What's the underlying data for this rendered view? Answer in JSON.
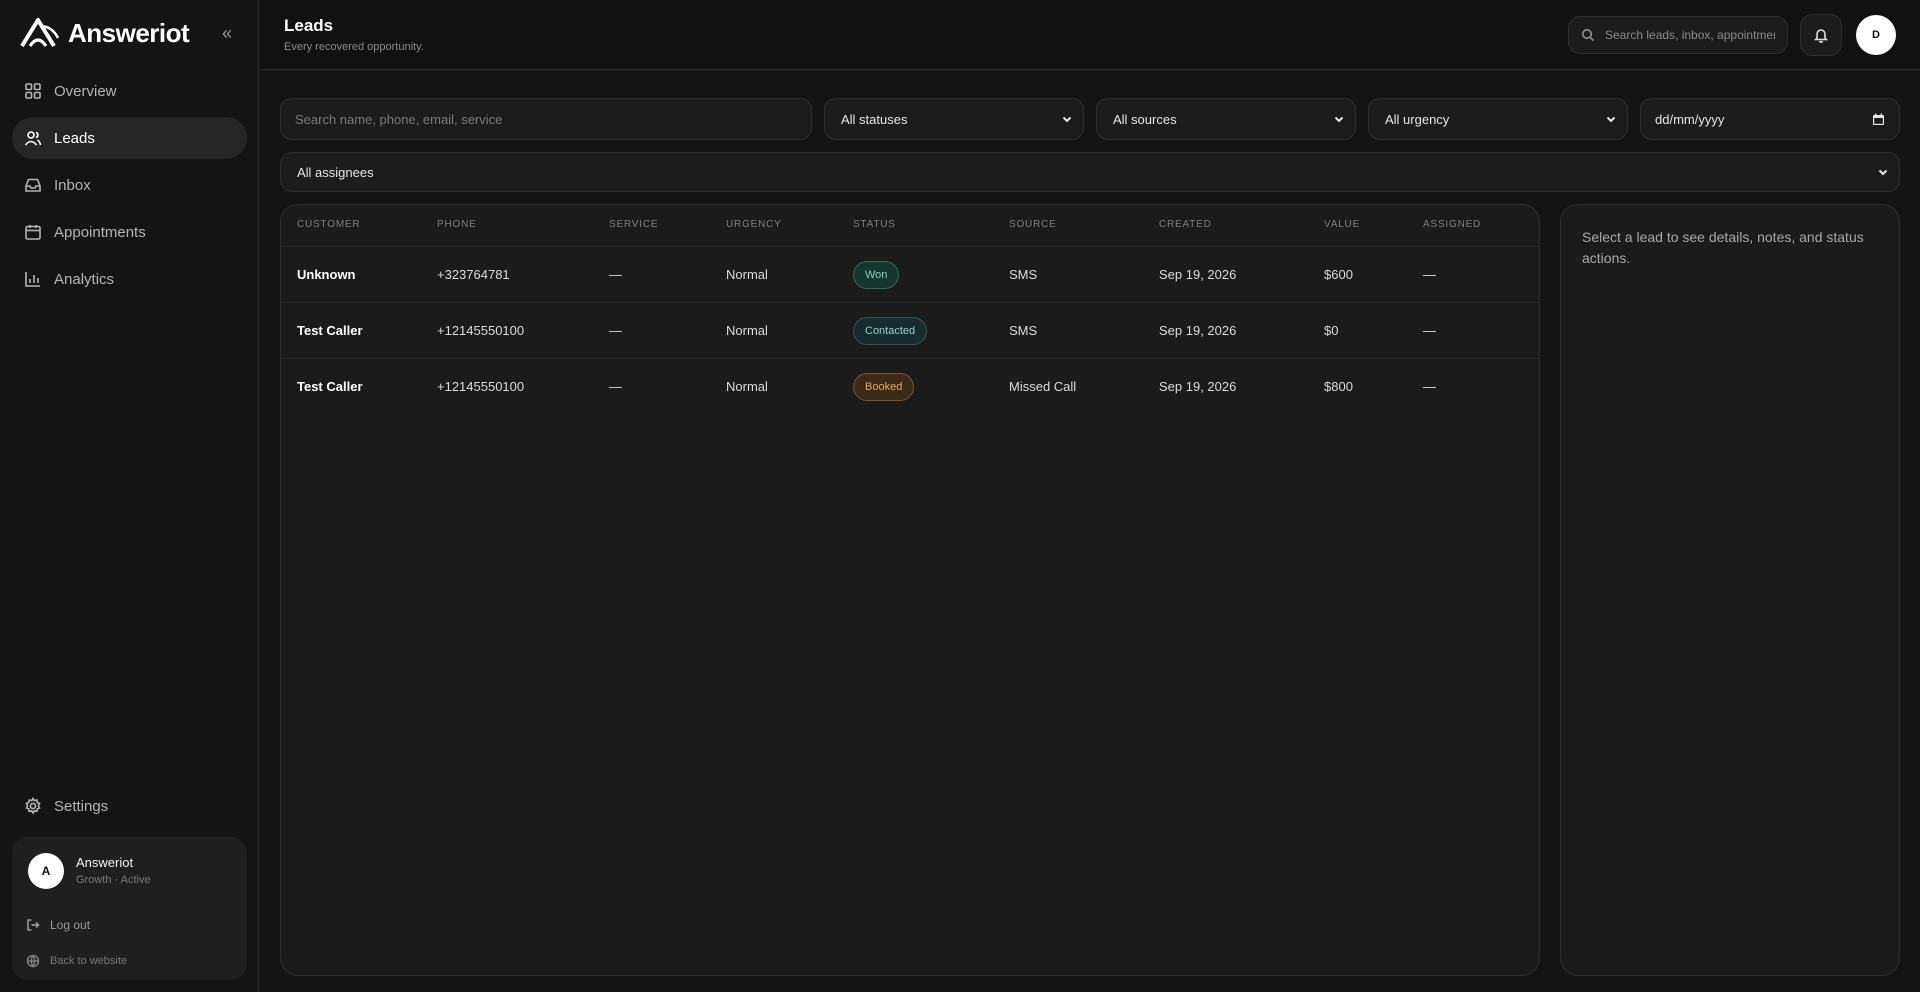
{
  "brand": {
    "name": "Answeriot"
  },
  "sidebar": {
    "collapse_label": "«",
    "items": [
      {
        "label": "Overview",
        "icon": "grid-icon",
        "active": false
      },
      {
        "label": "Leads",
        "icon": "users-icon",
        "active": true
      },
      {
        "label": "Inbox",
        "icon": "inbox-icon",
        "active": false
      },
      {
        "label": "Appointments",
        "icon": "calendar-icon",
        "active": false
      },
      {
        "label": "Analytics",
        "icon": "bar-chart-icon",
        "active": false
      }
    ],
    "settings_label": "Settings",
    "user": {
      "initial": "A",
      "name": "Answeriot",
      "plan": "Growth · Active",
      "logout_label": "Log out",
      "back_label": "Back to website"
    }
  },
  "header": {
    "title": "Leads",
    "subtitle": "Every recovered opportunity.",
    "search_placeholder": "Search leads, inbox, appointments",
    "avatar_initial": "D"
  },
  "filters": {
    "search_placeholder": "Search name, phone, email, service",
    "status": "All statuses",
    "source": "All sources",
    "urgency": "All urgency",
    "date_placeholder": "dd/mm/yyyy",
    "assignees": "All assignees"
  },
  "table": {
    "columns": [
      "CUSTOMER",
      "PHONE",
      "SERVICE",
      "URGENCY",
      "STATUS",
      "SOURCE",
      "CREATED",
      "VALUE",
      "ASSIGNED"
    ],
    "rows": [
      {
        "customer": "Unknown",
        "phone": "+323764781",
        "service": "—",
        "urgency": "Normal",
        "status": "Won",
        "status_kind": "won",
        "source": "SMS",
        "created": "Sep 19, 2026",
        "value": "$600",
        "assigned": "—"
      },
      {
        "customer": "Test Caller",
        "phone": "+12145550100",
        "service": "—",
        "urgency": "Normal",
        "status": "Contacted",
        "status_kind": "contacted",
        "source": "SMS",
        "created": "Sep 19, 2026",
        "value": "$0",
        "assigned": "—"
      },
      {
        "customer": "Test Caller",
        "phone": "+12145550100",
        "service": "—",
        "urgency": "Normal",
        "status": "Booked",
        "status_kind": "booked",
        "source": "Missed Call",
        "created": "Sep 19, 2026",
        "value": "$800",
        "assigned": "—"
      }
    ]
  },
  "detail": {
    "empty_text": "Select a lead to see details, notes, and status actions."
  },
  "colors": {
    "background": "#141414",
    "panel": "#1b1b1b",
    "won": "#7fd3bd",
    "contacted": "#8ad3cd",
    "booked": "#e2a866"
  }
}
